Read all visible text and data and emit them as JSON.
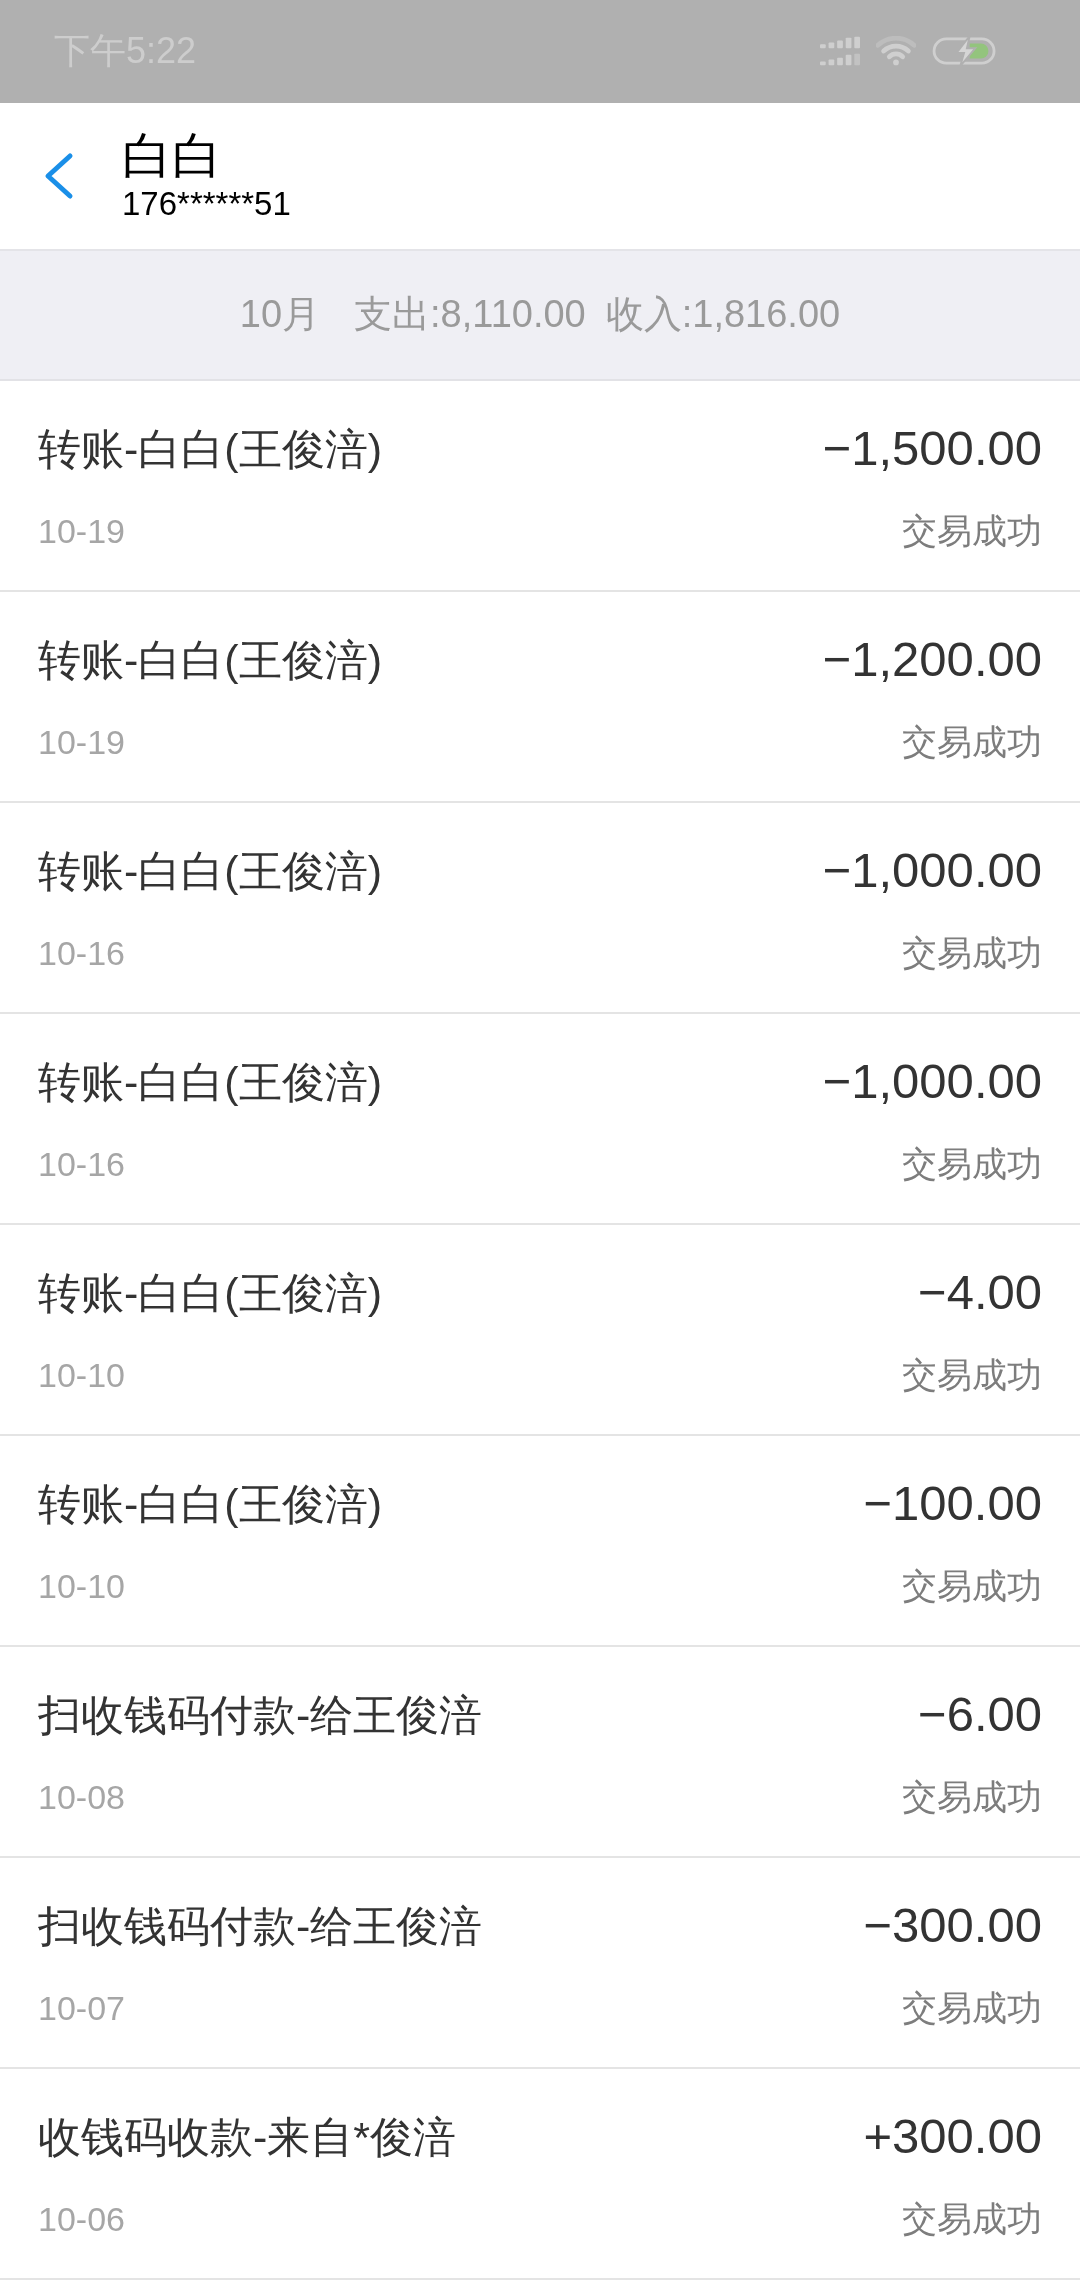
{
  "status_bar": {
    "time": "下午5:22"
  },
  "header": {
    "title": "白白",
    "subtitle": "176******51"
  },
  "summary": {
    "month": "10月",
    "expense": "支出:8,110.00",
    "income": "收入:1,816.00"
  },
  "transactions": [
    {
      "title": "转账-白白(王俊涪)",
      "amount": "−1,500.00",
      "date": "10-19",
      "status": "交易成功"
    },
    {
      "title": "转账-白白(王俊涪)",
      "amount": "−1,200.00",
      "date": "10-19",
      "status": "交易成功"
    },
    {
      "title": "转账-白白(王俊涪)",
      "amount": "−1,000.00",
      "date": "10-16",
      "status": "交易成功"
    },
    {
      "title": "转账-白白(王俊涪)",
      "amount": "−1,000.00",
      "date": "10-16",
      "status": "交易成功"
    },
    {
      "title": "转账-白白(王俊涪)",
      "amount": "−4.00",
      "date": "10-10",
      "status": "交易成功"
    },
    {
      "title": "转账-白白(王俊涪)",
      "amount": "−100.00",
      "date": "10-10",
      "status": "交易成功"
    },
    {
      "title": "扫收钱码付款-给王俊涪",
      "amount": "−6.00",
      "date": "10-08",
      "status": "交易成功"
    },
    {
      "title": "扫收钱码付款-给王俊涪",
      "amount": "−300.00",
      "date": "10-07",
      "status": "交易成功"
    },
    {
      "title": "收钱码收款-来自*俊涪",
      "amount": "+300.00",
      "date": "10-06",
      "status": "交易成功"
    }
  ]
}
